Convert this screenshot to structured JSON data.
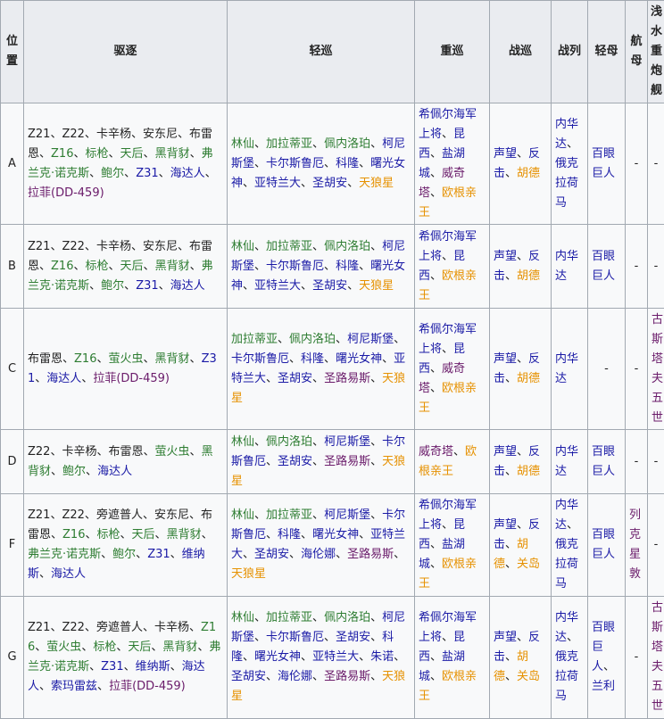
{
  "colors": {
    "black": "#222222",
    "green": "#2e7d32",
    "blue": "#1a1aa6",
    "purple": "#6a1b6a",
    "orange": "#e69100",
    "header_bg": "#eaecf0",
    "border": "#a2a9b1"
  },
  "headers": [
    "位置",
    "驱逐",
    "轻巡",
    "重巡",
    "战巡",
    "战列",
    "轻母",
    "航母",
    "浅水重炮舰"
  ],
  "rows": [
    {
      "pos": "A",
      "cells": [
        [
          [
            "Z21",
            "black"
          ],
          [
            "Z22",
            "black"
          ],
          [
            "卡辛杨",
            "black"
          ],
          [
            "安东尼",
            "black"
          ],
          [
            "布雷恩",
            "black"
          ],
          [
            "Z16",
            "green"
          ],
          [
            "标枪",
            "green"
          ],
          [
            "天后",
            "green"
          ],
          [
            "黑背豺",
            "green"
          ],
          [
            "弗兰克·诺克斯",
            "green"
          ],
          [
            "鲍尔",
            "green"
          ],
          [
            "Z31",
            "blue"
          ],
          [
            "海达人",
            "blue"
          ],
          [
            "拉菲(DD-459)",
            "purple"
          ]
        ],
        [
          [
            "林仙",
            "green"
          ],
          [
            "加拉蒂亚",
            "green"
          ],
          [
            "佩内洛珀",
            "green"
          ],
          [
            "柯尼斯堡",
            "blue"
          ],
          [
            "卡尔斯鲁厄",
            "blue"
          ],
          [
            "科隆",
            "blue"
          ],
          [
            "曙光女神",
            "blue"
          ],
          [
            "亚特兰大",
            "blue"
          ],
          [
            "圣胡安",
            "blue"
          ],
          [
            "天狼星",
            "orange"
          ]
        ],
        [
          [
            "希佩尔海军上将",
            "blue"
          ],
          [
            "昆西",
            "blue"
          ],
          [
            "盐湖城",
            "blue"
          ],
          [
            "威奇塔",
            "purple"
          ],
          [
            "欧根亲王",
            "orange"
          ]
        ],
        [
          [
            "声望",
            "blue"
          ],
          [
            "反击",
            "blue"
          ],
          [
            "胡德",
            "orange"
          ]
        ],
        [
          [
            "内华达",
            "blue"
          ],
          [
            "俄克拉荷马",
            "blue"
          ]
        ],
        [
          [
            "百眼巨人",
            "blue"
          ]
        ],
        [
          [
            "-",
            "black"
          ]
        ],
        [
          [
            "-",
            "black"
          ]
        ]
      ]
    },
    {
      "pos": "B",
      "cells": [
        [
          [
            "Z21",
            "black"
          ],
          [
            "Z22",
            "black"
          ],
          [
            "卡辛杨",
            "black"
          ],
          [
            "安东尼",
            "black"
          ],
          [
            "布雷恩",
            "black"
          ],
          [
            "Z16",
            "green"
          ],
          [
            "标枪",
            "green"
          ],
          [
            "天后",
            "green"
          ],
          [
            "黑背豺",
            "green"
          ],
          [
            "弗兰克·诺克斯",
            "green"
          ],
          [
            "鲍尔",
            "green"
          ],
          [
            "Z31",
            "blue"
          ],
          [
            "海达人",
            "blue"
          ]
        ],
        [
          [
            "林仙",
            "green"
          ],
          [
            "加拉蒂亚",
            "green"
          ],
          [
            "佩内洛珀",
            "green"
          ],
          [
            "柯尼斯堡",
            "blue"
          ],
          [
            "卡尔斯鲁厄",
            "blue"
          ],
          [
            "科隆",
            "blue"
          ],
          [
            "曙光女神",
            "blue"
          ],
          [
            "亚特兰大",
            "blue"
          ],
          [
            "圣胡安",
            "blue"
          ],
          [
            "天狼星",
            "orange"
          ]
        ],
        [
          [
            "希佩尔海军上将",
            "blue"
          ],
          [
            "昆西",
            "blue"
          ],
          [
            "欧根亲王",
            "orange"
          ]
        ],
        [
          [
            "声望",
            "blue"
          ],
          [
            "反击",
            "blue"
          ],
          [
            "胡德",
            "orange"
          ]
        ],
        [
          [
            "内华达",
            "blue"
          ]
        ],
        [
          [
            "百眼巨人",
            "blue"
          ]
        ],
        [
          [
            "-",
            "black"
          ]
        ],
        [
          [
            "-",
            "black"
          ]
        ]
      ]
    },
    {
      "pos": "C",
      "cells": [
        [
          [
            "布雷恩",
            "black"
          ],
          [
            "Z16",
            "green"
          ],
          [
            "萤火虫",
            "green"
          ],
          [
            "黑背豺",
            "green"
          ],
          [
            "Z31",
            "blue"
          ],
          [
            "海达人",
            "blue"
          ],
          [
            "拉菲(DD-459)",
            "purple"
          ]
        ],
        [
          [
            "加拉蒂亚",
            "green"
          ],
          [
            "佩内洛珀",
            "green"
          ],
          [
            "柯尼斯堡",
            "blue"
          ],
          [
            "卡尔斯鲁厄",
            "blue"
          ],
          [
            "科隆",
            "blue"
          ],
          [
            "曙光女神",
            "blue"
          ],
          [
            "亚特兰大",
            "blue"
          ],
          [
            "圣胡安",
            "blue"
          ],
          [
            "圣路易斯",
            "purple"
          ],
          [
            "天狼星",
            "orange"
          ]
        ],
        [
          [
            "希佩尔海军上将",
            "blue"
          ],
          [
            "昆西",
            "blue"
          ],
          [
            "威奇塔",
            "purple"
          ],
          [
            "欧根亲王",
            "orange"
          ]
        ],
        [
          [
            "声望",
            "blue"
          ],
          [
            "反击",
            "blue"
          ],
          [
            "胡德",
            "orange"
          ]
        ],
        [
          [
            "内华达",
            "blue"
          ]
        ],
        [
          [
            "-",
            "black"
          ]
        ],
        [
          [
            "-",
            "black"
          ]
        ],
        [
          [
            "古斯塔夫五世",
            "purple"
          ]
        ]
      ]
    },
    {
      "pos": "D",
      "cells": [
        [
          [
            "Z22",
            "black"
          ],
          [
            "卡辛杨",
            "black"
          ],
          [
            "布雷恩",
            "black"
          ],
          [
            "萤火虫",
            "green"
          ],
          [
            "黑背豺",
            "green"
          ],
          [
            "鲍尔",
            "green"
          ],
          [
            "海达人",
            "blue"
          ]
        ],
        [
          [
            "林仙",
            "green"
          ],
          [
            "佩内洛珀",
            "green"
          ],
          [
            "柯尼斯堡",
            "blue"
          ],
          [
            "卡尔斯鲁厄",
            "blue"
          ],
          [
            "圣胡安",
            "blue"
          ],
          [
            "圣路易斯",
            "purple"
          ],
          [
            "天狼星",
            "orange"
          ]
        ],
        [
          [
            "威奇塔",
            "purple"
          ],
          [
            "欧根亲王",
            "orange"
          ]
        ],
        [
          [
            "声望",
            "blue"
          ],
          [
            "反击",
            "blue"
          ],
          [
            "胡德",
            "orange"
          ]
        ],
        [
          [
            "内华达",
            "blue"
          ]
        ],
        [
          [
            "百眼巨人",
            "blue"
          ]
        ],
        [
          [
            "-",
            "black"
          ]
        ],
        [
          [
            "-",
            "black"
          ]
        ]
      ]
    },
    {
      "pos": "F",
      "cells": [
        [
          [
            "Z21",
            "black"
          ],
          [
            "Z22",
            "black"
          ],
          [
            "旁遮普人",
            "black"
          ],
          [
            "安东尼",
            "black"
          ],
          [
            "布雷恩",
            "black"
          ],
          [
            "Z16",
            "green"
          ],
          [
            "标枪",
            "green"
          ],
          [
            "天后",
            "green"
          ],
          [
            "黑背豺",
            "green"
          ],
          [
            "弗兰克·诺克斯",
            "green"
          ],
          [
            "鲍尔",
            "green"
          ],
          [
            "Z31",
            "blue"
          ],
          [
            "维纳斯",
            "blue"
          ],
          [
            "海达人",
            "blue"
          ]
        ],
        [
          [
            "林仙",
            "green"
          ],
          [
            "加拉蒂亚",
            "green"
          ],
          [
            "柯尼斯堡",
            "blue"
          ],
          [
            "卡尔斯鲁厄",
            "blue"
          ],
          [
            "科隆",
            "blue"
          ],
          [
            "曙光女神",
            "blue"
          ],
          [
            "亚特兰大",
            "blue"
          ],
          [
            "圣胡安",
            "blue"
          ],
          [
            "海伦娜",
            "blue"
          ],
          [
            "圣路易斯",
            "purple"
          ],
          [
            "天狼星",
            "orange"
          ]
        ],
        [
          [
            "希佩尔海军上将",
            "blue"
          ],
          [
            "昆西",
            "blue"
          ],
          [
            "盐湖城",
            "blue"
          ],
          [
            "欧根亲王",
            "orange"
          ]
        ],
        [
          [
            "声望",
            "blue"
          ],
          [
            "反击",
            "blue"
          ],
          [
            "胡德",
            "orange"
          ],
          [
            "关岛",
            "orange"
          ]
        ],
        [
          [
            "内华达",
            "blue"
          ],
          [
            "俄克拉荷马",
            "blue"
          ]
        ],
        [
          [
            "百眼巨人",
            "blue"
          ]
        ],
        [
          [
            "列克星敦",
            "purple"
          ]
        ],
        [
          [
            "-",
            "black"
          ]
        ]
      ]
    },
    {
      "pos": "G",
      "cells": [
        [
          [
            "Z21",
            "black"
          ],
          [
            "Z22",
            "black"
          ],
          [
            "旁遮普人",
            "black"
          ],
          [
            "卡辛杨",
            "black"
          ],
          [
            "Z16",
            "green"
          ],
          [
            "萤火虫",
            "green"
          ],
          [
            "标枪",
            "green"
          ],
          [
            "天后",
            "green"
          ],
          [
            "黑背豺",
            "green"
          ],
          [
            "弗兰克·诺克斯",
            "green"
          ],
          [
            "Z31",
            "blue"
          ],
          [
            "维纳斯",
            "blue"
          ],
          [
            "海达人",
            "blue"
          ],
          [
            "索玛雷兹",
            "blue"
          ],
          [
            "拉菲(DD-459)",
            "purple"
          ]
        ],
        [
          [
            "林仙",
            "green"
          ],
          [
            "加拉蒂亚",
            "green"
          ],
          [
            "佩内洛珀",
            "green"
          ],
          [
            "柯尼斯堡",
            "blue"
          ],
          [
            "卡尔斯鲁厄",
            "blue"
          ],
          [
            "圣胡安",
            "blue"
          ],
          [
            "科隆",
            "blue"
          ],
          [
            "曙光女神",
            "blue"
          ],
          [
            "亚特兰大",
            "blue"
          ],
          [
            "朱诺",
            "blue"
          ],
          [
            "圣胡安",
            "blue"
          ],
          [
            "海伦娜",
            "blue"
          ],
          [
            "圣路易斯",
            "purple"
          ],
          [
            "天狼星",
            "orange"
          ]
        ],
        [
          [
            "希佩尔海军上将",
            "blue"
          ],
          [
            "昆西",
            "blue"
          ],
          [
            "盐湖城",
            "blue"
          ],
          [
            "欧根亲王",
            "orange"
          ]
        ],
        [
          [
            "声望",
            "blue"
          ],
          [
            "反击",
            "blue"
          ],
          [
            "胡德",
            "orange"
          ],
          [
            "关岛",
            "orange"
          ]
        ],
        [
          [
            "内华达",
            "blue"
          ],
          [
            "俄克拉荷马",
            "blue"
          ]
        ],
        [
          [
            "百眼巨人",
            "blue"
          ],
          [
            "兰利",
            "blue"
          ]
        ],
        [
          [
            "-",
            "black"
          ]
        ],
        [
          [
            "古斯塔夫五世",
            "purple"
          ]
        ]
      ]
    }
  ]
}
